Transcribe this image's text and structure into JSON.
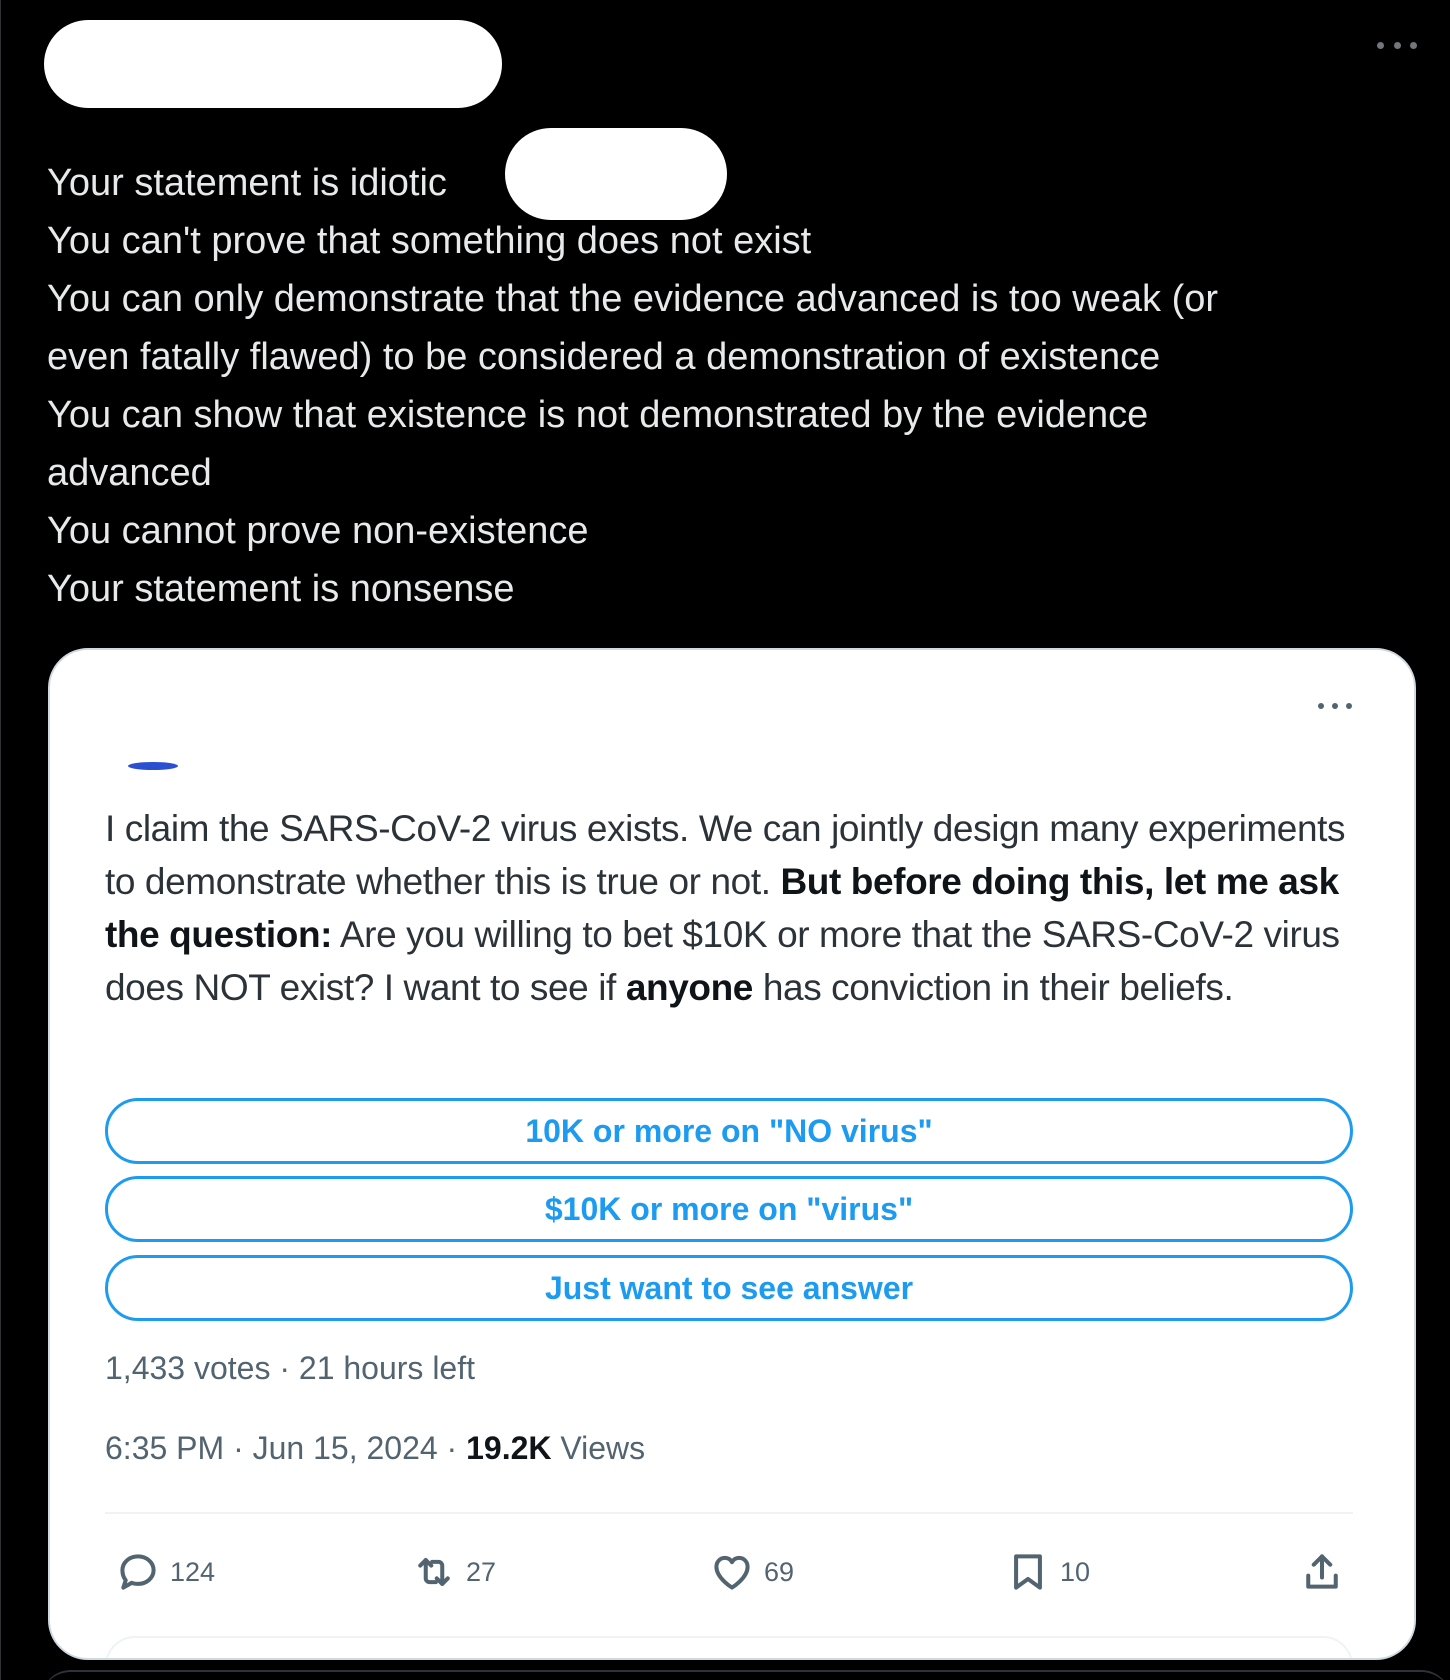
{
  "reply": {
    "name_fragment": "",
    "lines": [
      "Your statement is idiotic",
      "You can't prove that something does not exist",
      "You can only demonstrate that the evidence advanced is too weak (or",
      "even fatally flawed) to be considered a demonstration of existence",
      "You can show that existence is not demonstrated by the evidence",
      "advanced",
      "You cannot prove non-existence",
      "Your statement is nonsense"
    ]
  },
  "quoted_tweet": {
    "handle_fragment": "",
    "text_parts": {
      "p1": "I claim the SARS-CoV-2 virus exists. We can jointly design many experiments to demonstrate whether this is true or not. ",
      "bold1": "But before doing this, let me ask the question:",
      "p2": " Are you willing to bet $10K or more that the SARS-CoV-2 virus does NOT exist? I want to see if ",
      "bold2": "anyone",
      "p3": " has conviction in their beliefs."
    },
    "poll": {
      "options": [
        "10K or more on \"NO virus\"",
        "$10K or more on \"virus\"",
        "Just want to see answer"
      ],
      "meta": "1,433 votes · 21 hours left"
    },
    "timestamp": {
      "time_date": "6:35 PM · Jun 15, 2024 · ",
      "views_count": "19.2K",
      "views_label": " Views"
    },
    "actions": {
      "replies": "124",
      "reposts": "27",
      "likes": "69",
      "bookmarks": "10"
    }
  },
  "colors": {
    "background": "#000000",
    "card_background": "#ffffff",
    "accent": "#1d9bf0",
    "text_dark_mode": "#e7e9ea",
    "muted": "#536471"
  },
  "icons": [
    "more-icon",
    "reply-icon",
    "repost-icon",
    "like-icon",
    "bookmark-icon",
    "share-icon"
  ]
}
